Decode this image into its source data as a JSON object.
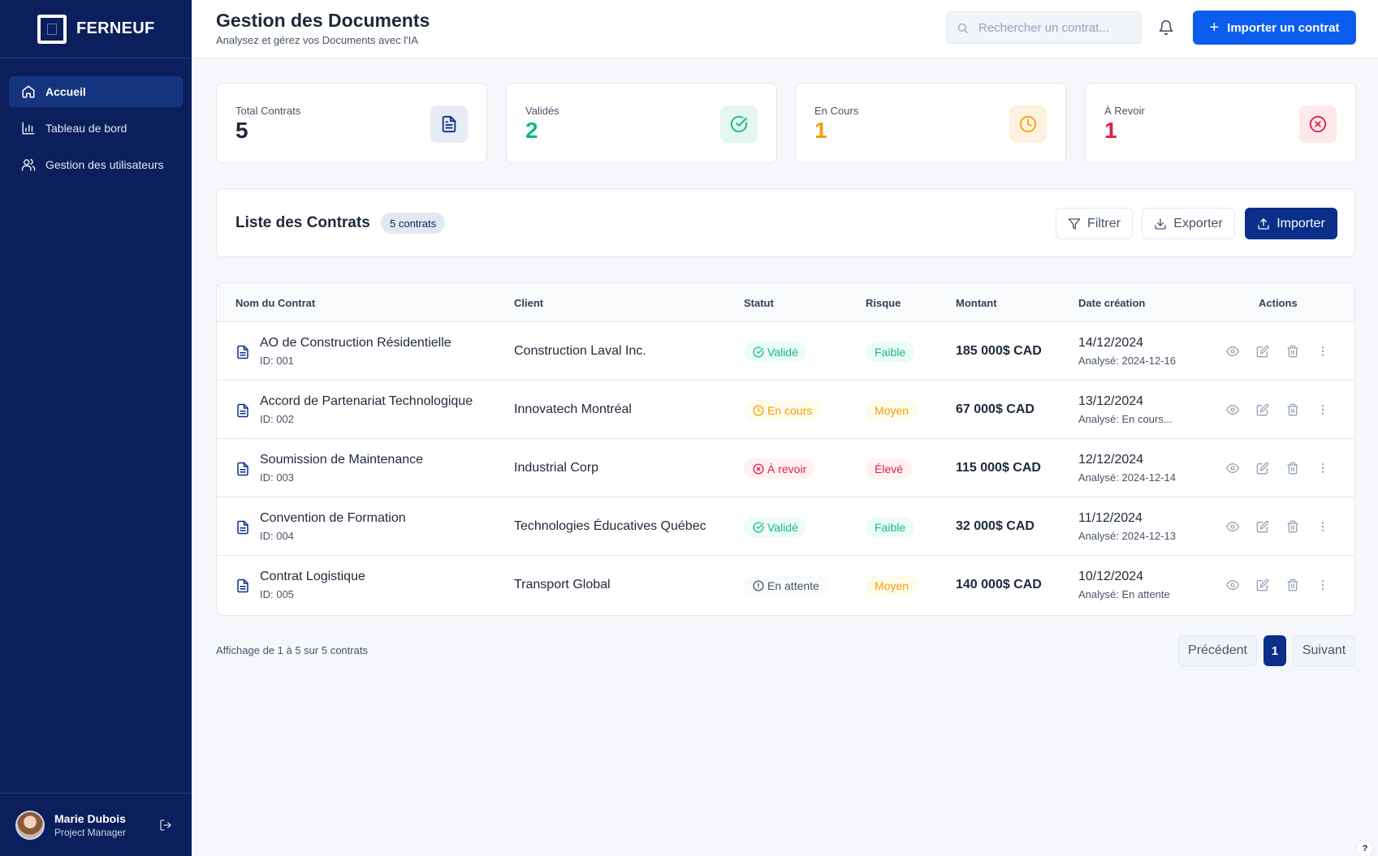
{
  "sidebar": {
    "brand": "FERNEUF",
    "items": [
      {
        "label": "Accueil",
        "icon": "home-icon"
      },
      {
        "label": "Tableau de bord",
        "icon": "bar-chart-icon"
      },
      {
        "label": "Gestion des utilisateurs",
        "icon": "users-icon"
      }
    ],
    "user": {
      "name": "Marie Dubois",
      "role": "Project Manager"
    }
  },
  "header": {
    "title": "Gestion des Documents",
    "subtitle": "Analysez et gérez vos Documents avec l'IA",
    "search_placeholder": "Rechercher un contrat...",
    "import_label": "Importer un contrat"
  },
  "stats": [
    {
      "label": "Total Contrats",
      "value": "5",
      "color": "#0b2e8a",
      "bg": "#e6ebf5"
    },
    {
      "label": "Validés",
      "value": "2",
      "color": "#10b981",
      "bg": "#e3f7ef"
    },
    {
      "label": "En Cours",
      "value": "1",
      "color": "#f59e0b",
      "bg": "#fef3e1"
    },
    {
      "label": "À Revoir",
      "value": "1",
      "color": "#e11d48",
      "bg": "#fde8ea"
    }
  ],
  "list": {
    "title": "Liste des Contrats",
    "count_badge": "5 contrats",
    "filter_label": "Filtrer",
    "export_label": "Exporter",
    "import_label": "Importer"
  },
  "table": {
    "columns": [
      "Nom du Contrat",
      "Client",
      "Statut",
      "Risque",
      "Montant",
      "Date création",
      "Actions"
    ],
    "rows": [
      {
        "name": "AO de Construction Résidentielle",
        "id": "ID: 001",
        "client": "Construction Laval Inc.",
        "status": "Validé",
        "risk": "Faible",
        "amount": "185 000$ CAD",
        "date": "14/12/2024",
        "analysed": "Analysé: 2024-12-16"
      },
      {
        "name": "Accord de Partenariat Technologique",
        "id": "ID: 002",
        "client": "Innovatech Montréal",
        "status": "En cours",
        "risk": "Moyen",
        "amount": "67 000$ CAD",
        "date": "13/12/2024",
        "analysed": "Analysé: En cours..."
      },
      {
        "name": "Soumission de Maintenance",
        "id": "ID: 003",
        "client": "Industrial Corp",
        "status": "À revoir",
        "risk": "Élevé",
        "amount": "115 000$ CAD",
        "date": "12/12/2024",
        "analysed": "Analysé: 2024-12-14"
      },
      {
        "name": "Convention de Formation",
        "id": "ID: 004",
        "client": "Technologies Éducatives Québec",
        "status": "Validé",
        "risk": "Faible",
        "amount": "32 000$ CAD",
        "date": "11/12/2024",
        "analysed": "Analysé: 2024-12-13"
      },
      {
        "name": "Contrat Logistique",
        "id": "ID: 005",
        "client": "Transport Global",
        "status": "En attente",
        "risk": "Moyen",
        "amount": "140 000$ CAD",
        "date": "10/12/2024",
        "analysed": "Analysé: En attente"
      }
    ]
  },
  "pagination": {
    "showing": "Affichage de 1 à 5 sur 5 contrats",
    "prev": "Précédent",
    "current": "1",
    "next": "Suivant"
  },
  "help_label": "?",
  "colors": {
    "sidebar": "#0b1f5c",
    "primary": "#0d5cf0",
    "navy_button": "#0b2e8a"
  }
}
